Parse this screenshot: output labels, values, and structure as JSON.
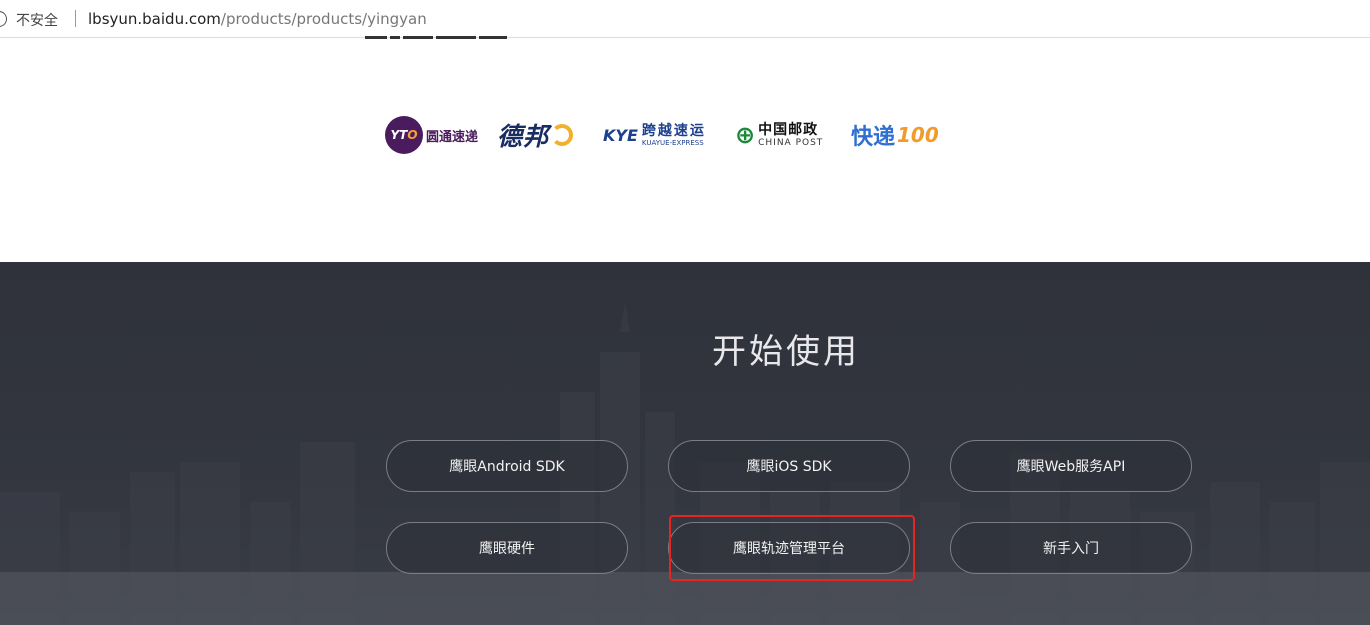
{
  "browser": {
    "security_label": "不安全",
    "url_host": "lbsyun.baidu.com",
    "url_path": "/products/products/yingyan"
  },
  "partners": {
    "yto": {
      "mark": "YT",
      "mark_x": "O",
      "name": "圆通速递"
    },
    "deppon": {
      "name": "德邦"
    },
    "kye": {
      "mark": "KYE",
      "name_cn": "跨越速运",
      "name_en": "KUAYUE-EXPRESS"
    },
    "post": {
      "mark": "⊕",
      "name_cn": "中国邮政",
      "name_en": "CHINA POST"
    },
    "kd100": {
      "name_cn": "快递",
      "name_num": "100"
    }
  },
  "start": {
    "heading": "开始使用",
    "buttons": [
      {
        "label": "鹰眼Android SDK"
      },
      {
        "label": "鹰眼iOS SDK"
      },
      {
        "label": "鹰眼Web服务API"
      },
      {
        "label": "鹰眼硬件"
      },
      {
        "label": "鹰眼轨迹管理平台"
      },
      {
        "label": "新手入门"
      }
    ]
  },
  "colors": {
    "dark_bg": "#2f323b",
    "highlight": "#e52424",
    "button_border": "#7a7d86"
  }
}
